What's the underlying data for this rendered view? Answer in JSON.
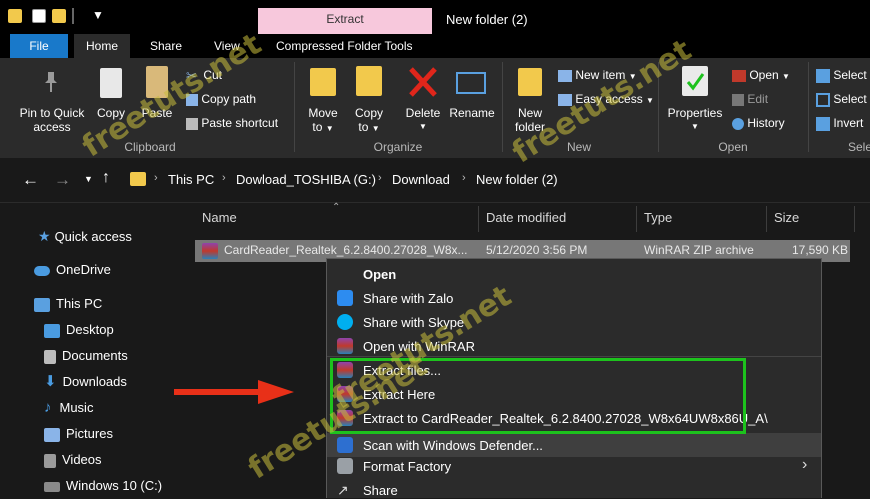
{
  "window": {
    "title": "New folder (2)",
    "contextual_tab_header": "Extract"
  },
  "tabs": {
    "file": "File",
    "home": "Home",
    "share": "Share",
    "view": "View",
    "compressed": "Compressed Folder Tools"
  },
  "ribbon": {
    "clipboard": {
      "pin_line1": "Pin to Quick",
      "pin_line2": "access",
      "copy": "Copy",
      "paste": "Paste",
      "cut": "Cut",
      "copy_path": "Copy path",
      "paste_shortcut": "Paste shortcut",
      "group": "Clipboard"
    },
    "organize": {
      "move_line1": "Move",
      "move_line2": "to",
      "copy_line1": "Copy",
      "copy_line2": "to",
      "delete": "Delete",
      "rename": "Rename",
      "group": "Organize"
    },
    "new": {
      "new_folder_line1": "New",
      "new_folder_line2": "folder",
      "new_item": "New item",
      "easy_access": "Easy access",
      "group": "New"
    },
    "open": {
      "properties": "Properties",
      "open": "Open",
      "edit": "Edit",
      "history": "History",
      "group": "Open"
    },
    "select": {
      "select_all": "Select",
      "select_none": "Select",
      "invert": "Invert",
      "group": "Sele"
    }
  },
  "breadcrumb": [
    "This PC",
    "Dowload_TOSHIBA (G:)",
    "Download",
    "New folder (2)"
  ],
  "nav": {
    "quick_access": "Quick access",
    "onedrive": "OneDrive",
    "this_pc": "This PC",
    "desktop": "Desktop",
    "documents": "Documents",
    "downloads": "Downloads",
    "music": "Music",
    "pictures": "Pictures",
    "videos": "Videos",
    "windows_c": "Windows 10 (C:)"
  },
  "columns": {
    "name": "Name",
    "date": "Date modified",
    "type": "Type",
    "size": "Size"
  },
  "file": {
    "name": "CardReader_Realtek_6.2.8400.27028_W8x...",
    "date": "5/12/2020 3:56 PM",
    "type": "WinRAR ZIP archive",
    "size": "17,590 KB"
  },
  "context_menu": {
    "open": "Open",
    "share_zalo": "Share with Zalo",
    "share_skype": "Share with Skype",
    "open_winrar": "Open with WinRAR",
    "extract_files": "Extract files...",
    "extract_here": "Extract Here",
    "extract_to": "Extract to CardReader_Realtek_6.2.8400.27028_W8x64UW8x86U_A\\",
    "scan_defender": "Scan with Windows Defender...",
    "format_factory": "Format Factory",
    "share": "Share"
  },
  "watermark": "freetuts.net",
  "colors": {
    "file_tab": "#1979ca",
    "contextual_tab": "#f7c8dc",
    "highlight_box": "#1dc21d",
    "arrow": "#e83018"
  }
}
